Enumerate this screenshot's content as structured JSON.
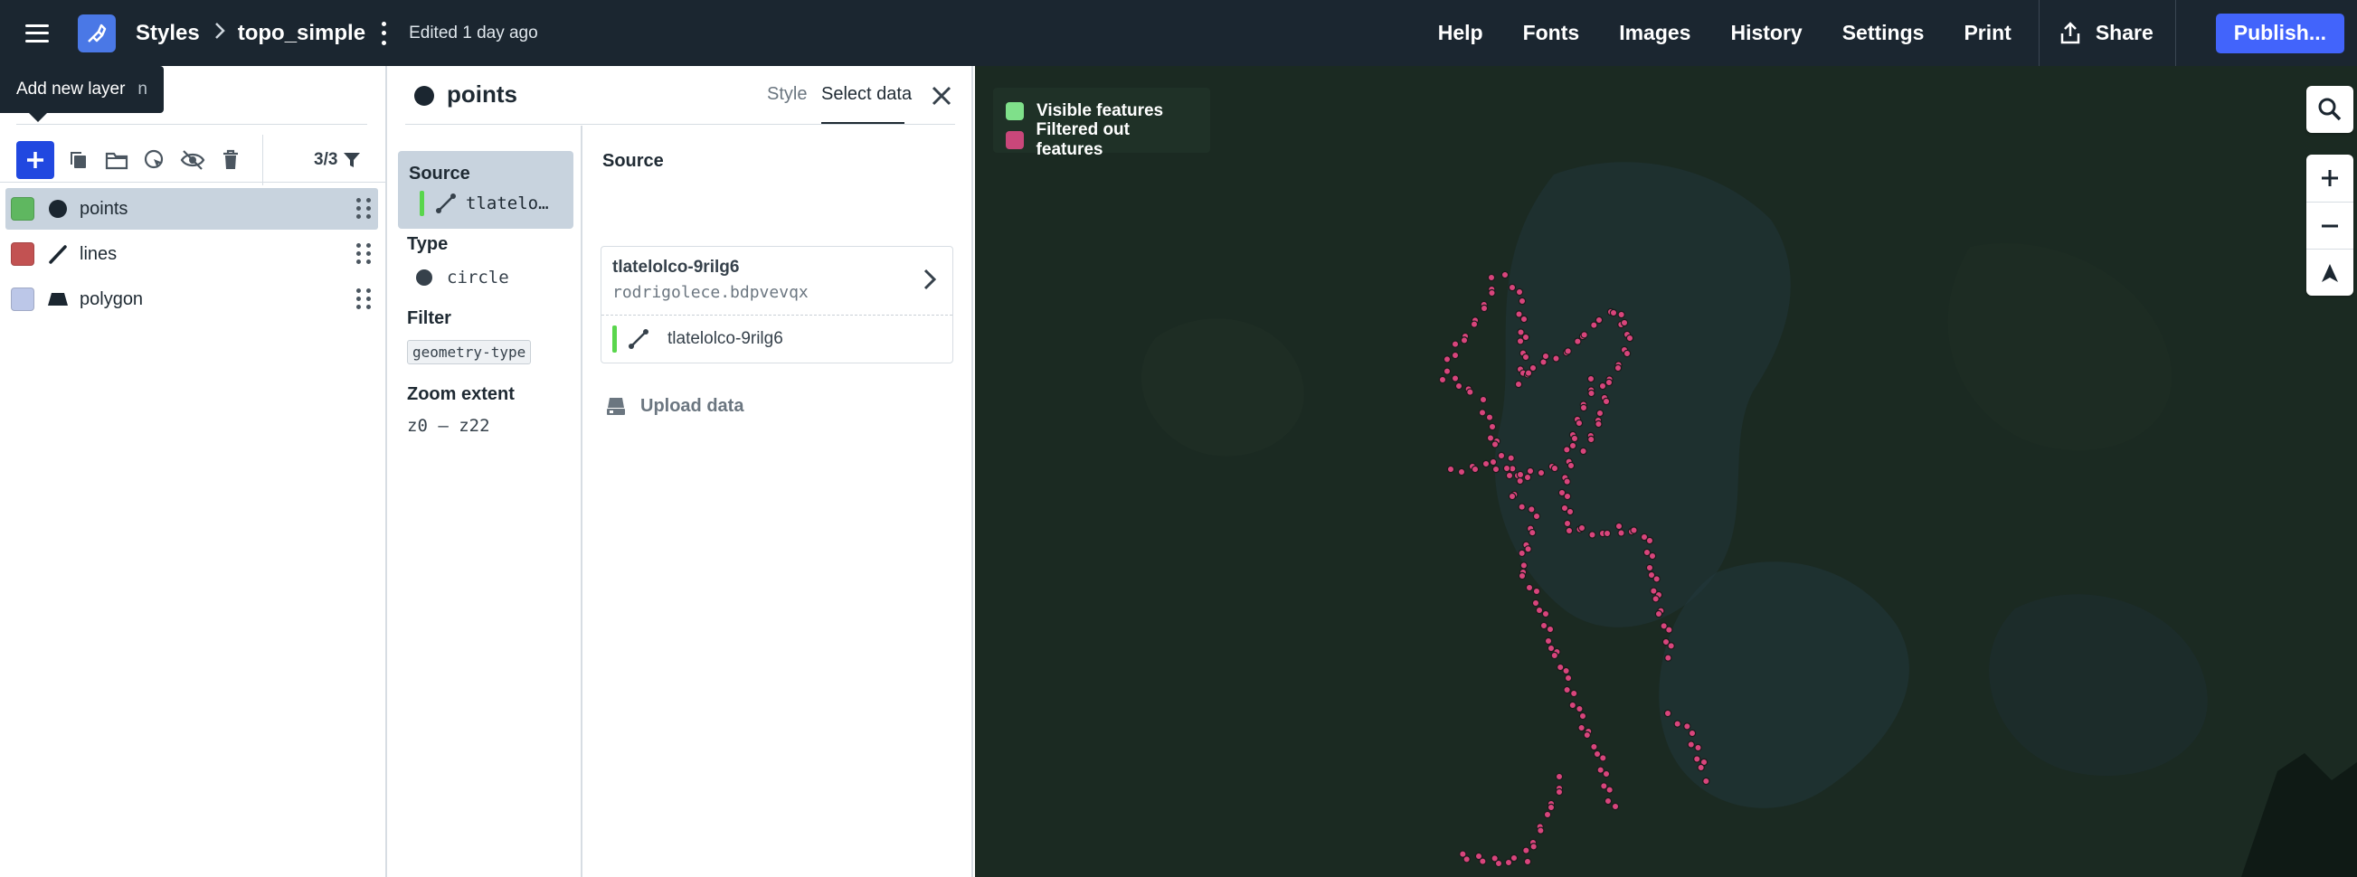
{
  "header": {
    "breadcrumb_root": "Styles",
    "style_name": "topo_simple",
    "edited_text": "Edited 1 day ago",
    "nav": [
      "Help",
      "Fonts",
      "Images",
      "History",
      "Settings",
      "Print"
    ],
    "share_label": "Share",
    "publish_label": "Publish..."
  },
  "tooltip": {
    "text": "Add new layer",
    "shortcut": "n"
  },
  "layer_panel": {
    "count": "3/3",
    "layers": [
      {
        "name": "points",
        "color": "#5fb760",
        "type": "circle"
      },
      {
        "name": "lines",
        "color": "#c25252",
        "type": "line"
      },
      {
        "name": "polygon",
        "color": "#bcc7e8",
        "type": "fill"
      }
    ]
  },
  "editor": {
    "layer_name": "points",
    "tabs": [
      "Style",
      "Select data"
    ],
    "active_tab": "Select data",
    "source_label": "Source",
    "source_value": "tlatelo…",
    "type_label": "Type",
    "type_value": "circle",
    "filter_label": "Filter",
    "filter_value": "geometry-type",
    "zoom_label": "Zoom extent",
    "zoom_value": "z0 – z22",
    "right_source_label": "Source",
    "source_id": "tlatelolco-9rilg6",
    "source_user": "rodrigolece.bdpvevqx",
    "source_layer": "tlatelolco-9rilg6",
    "upload_label": "Upload data"
  },
  "map": {
    "legend": [
      {
        "label": "Visible features",
        "color": "#7fe08a"
      },
      {
        "label": "Filtered out features",
        "color": "#c9477a"
      }
    ],
    "point_color": "#d8457c"
  }
}
